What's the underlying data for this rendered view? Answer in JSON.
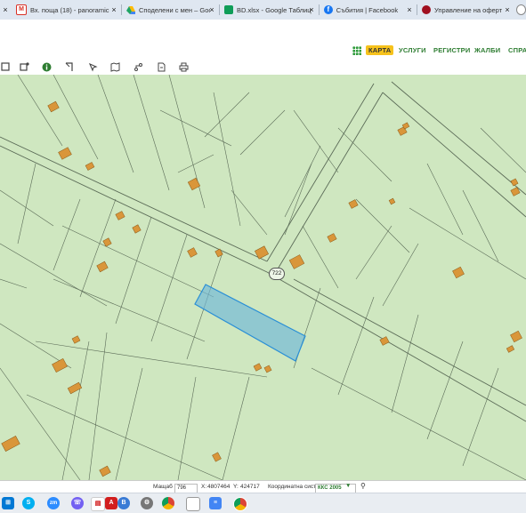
{
  "browser": {
    "tabs": [
      {
        "title": "Вх. поща (18) - panoramic",
        "icon": "gmail-icon",
        "color": "#d93025"
      },
      {
        "title": "Споделени с мен – Goog",
        "icon": "google-drive-icon",
        "color": "#1fa463"
      },
      {
        "title": "BD.xlsx - Google Таблици",
        "icon": "google-sheets-icon",
        "color": "#0f9d58"
      },
      {
        "title": "Събития | Facebook",
        "icon": "facebook-icon",
        "color": "#1877f2"
      },
      {
        "title": "Управление на оферти",
        "icon": "site-icon",
        "color": "#a01020"
      }
    ],
    "close_glyph": "×"
  },
  "nav": {
    "items": [
      "КАРТА",
      "УСЛУГИ",
      "РЕГИСТРИ",
      "ЖАЛБИ",
      "СПРА"
    ],
    "active": "КАРТА"
  },
  "toolbar": {
    "tools": [
      "select-rect-icon",
      "select-area-icon",
      "info-icon",
      "measure-icon",
      "pointer-icon",
      "book-icon",
      "route-icon",
      "document-icon",
      "print-icon"
    ]
  },
  "map": {
    "road_label": "722",
    "colors": {
      "land": "#cfe7c0",
      "building": "#d9963a",
      "selection": "#6fb7d8",
      "line": "#5b6b57"
    }
  },
  "status": {
    "scale_label": "Мащаб 1:",
    "scale_value": "796",
    "x_label": "X:",
    "x_value": "4807464",
    "y_label": "Y:",
    "y_value": "424717",
    "crs_label": "Координатна система:",
    "crs_value": "ККС 2005"
  },
  "taskbar": {
    "icons": [
      "start-icon",
      "skype-icon",
      "search-icon",
      "zoom-icon",
      "viber-icon",
      "pdf-icon",
      "acrobat-icon",
      "browser-b-icon",
      "settings-icon",
      "chrome-icon",
      "file-icon",
      "google-docs-icon",
      "chrome-profile-icon"
    ]
  }
}
